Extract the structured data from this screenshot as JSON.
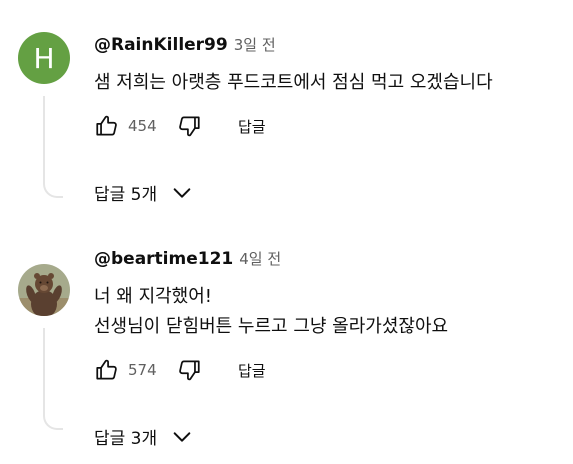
{
  "comments": [
    {
      "author": "@RainKiller99",
      "time": "3일 전",
      "avatar_letter": "H",
      "avatar_color": "#64a043",
      "lines": [
        "샘 저희는 아랫층 푸드코트에서 점심 먹고 오겠습니다"
      ],
      "likes": "454",
      "reply_label": "답글",
      "replies_label": "답글 5개"
    },
    {
      "author": "@beartime121",
      "time": "4일 전",
      "lines": [
        "너 왜 지각했어!",
        "선생님이 닫힘버튼 누르고 그냥 올라가셨잖아요"
      ],
      "likes": "574",
      "reply_label": "답글",
      "replies_label": "답글 3개"
    }
  ],
  "icons": {
    "like": "thumbs-up-icon",
    "dislike": "thumbs-down-icon",
    "expand": "chevron-down-icon"
  }
}
